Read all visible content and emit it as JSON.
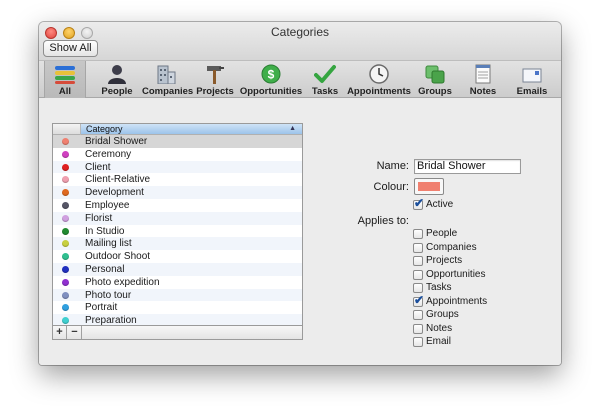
{
  "window": {
    "title": "Categories",
    "show_all_label": "Show All"
  },
  "toolbar": {
    "items": [
      {
        "label": "All",
        "icon": "all-icon",
        "selected": true
      },
      {
        "label": "People",
        "icon": "person-icon"
      },
      {
        "label": "Companies",
        "icon": "building-icon"
      },
      {
        "label": "Projects",
        "icon": "hammer-icon"
      },
      {
        "label": "Opportunities",
        "icon": "dollar-icon"
      },
      {
        "label": "Tasks",
        "icon": "checkmark-icon"
      },
      {
        "label": "Appointments",
        "icon": "clock-icon"
      },
      {
        "label": "Groups",
        "icon": "groups-icon"
      },
      {
        "label": "Notes",
        "icon": "notes-icon"
      },
      {
        "label": "Emails",
        "icon": "envelope-icon"
      }
    ]
  },
  "categories": {
    "header": "Category",
    "rows": [
      {
        "label": "Bridal Shower",
        "color": "#f08070"
      },
      {
        "label": "Ceremony",
        "color": "#d040c0"
      },
      {
        "label": "Client",
        "color": "#e02020"
      },
      {
        "label": "Client-Relative",
        "color": "#f0a0b0"
      },
      {
        "label": "Development",
        "color": "#e06a20"
      },
      {
        "label": "Employee",
        "color": "#555566"
      },
      {
        "label": "Florist",
        "color": "#d0a0e0"
      },
      {
        "label": "In Studio",
        "color": "#208a30"
      },
      {
        "label": "Mailing list",
        "color": "#c8d040"
      },
      {
        "label": "Outdoor Shoot",
        "color": "#30c090"
      },
      {
        "label": "Personal",
        "color": "#2030c0"
      },
      {
        "label": "Photo expedition",
        "color": "#9030d0"
      },
      {
        "label": "Photo tour",
        "color": "#8090c0"
      },
      {
        "label": "Portrait",
        "color": "#30a0e0"
      },
      {
        "label": "Preparation",
        "color": "#40d0d0"
      }
    ],
    "add_label": "+",
    "remove_label": "−"
  },
  "form": {
    "name_label": "Name:",
    "name_value": "Bridal Shower",
    "colour_label": "Colour:",
    "colour_value": "#f08070",
    "active_label": "Active",
    "active_checked": true,
    "applies_label": "Applies to:",
    "applies": [
      {
        "label": "People",
        "checked": false
      },
      {
        "label": "Companies",
        "checked": false
      },
      {
        "label": "Projects",
        "checked": false
      },
      {
        "label": "Opportunities",
        "checked": false
      },
      {
        "label": "Tasks",
        "checked": false
      },
      {
        "label": "Appointments",
        "checked": true
      },
      {
        "label": "Groups",
        "checked": false
      },
      {
        "label": "Notes",
        "checked": false
      },
      {
        "label": "Email",
        "checked": false
      }
    ]
  }
}
